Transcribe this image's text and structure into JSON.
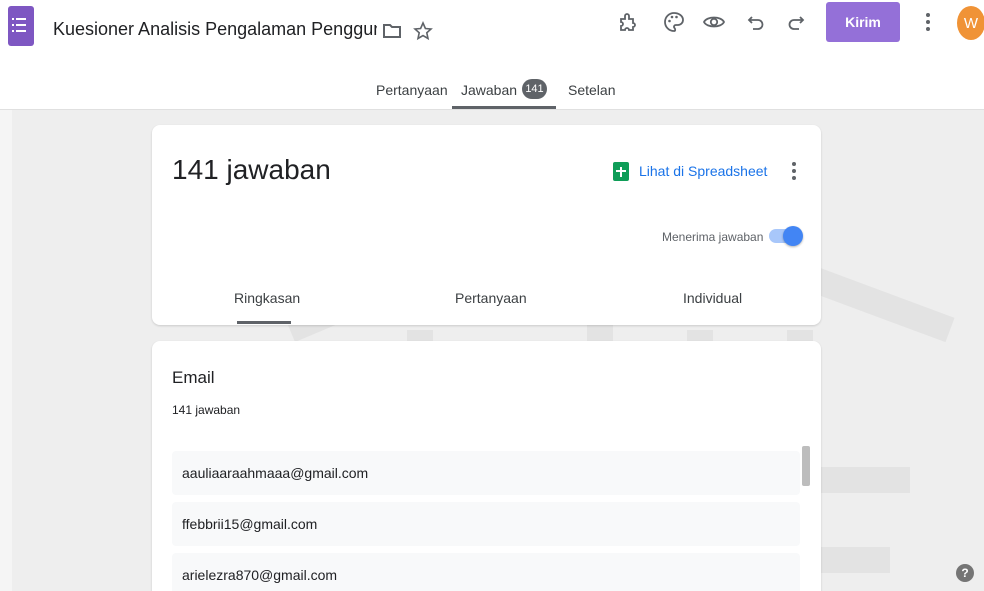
{
  "header": {
    "title": "Kuesioner Analisis Pengalaman Pengguna Thre",
    "send_label": "Kirim",
    "avatar_initial": "W",
    "icons": [
      "folder-icon",
      "star-icon",
      "addon-icon",
      "palette-icon",
      "preview-icon",
      "undo-icon",
      "redo-icon",
      "more-vert-icon"
    ]
  },
  "top_tabs": {
    "questions": "Pertanyaan",
    "responses": "Jawaban",
    "responses_count": "141",
    "settings": "Setelan",
    "active": "responses"
  },
  "summary_card": {
    "response_count_text": "141 jawaban",
    "sheet_link": "Lihat di Spreadsheet",
    "accepting_label": "Menerima jawaban",
    "accepting_on": true,
    "tabs": [
      "Ringkasan",
      "Pertanyaan",
      "Individual"
    ],
    "active_tab": "Ringkasan"
  },
  "question_card": {
    "title": "Email",
    "subtitle": "141 jawaban",
    "answers": [
      "aauliaaraahmaaa@gmail.com",
      "ffebbrii15@gmail.com",
      "arielezra870@gmail.com"
    ]
  },
  "help_label": "?",
  "colors": {
    "accent": "#9470d8",
    "link": "#1a73e8",
    "sheets": "#0f9d58",
    "avatar": "#f09336"
  }
}
